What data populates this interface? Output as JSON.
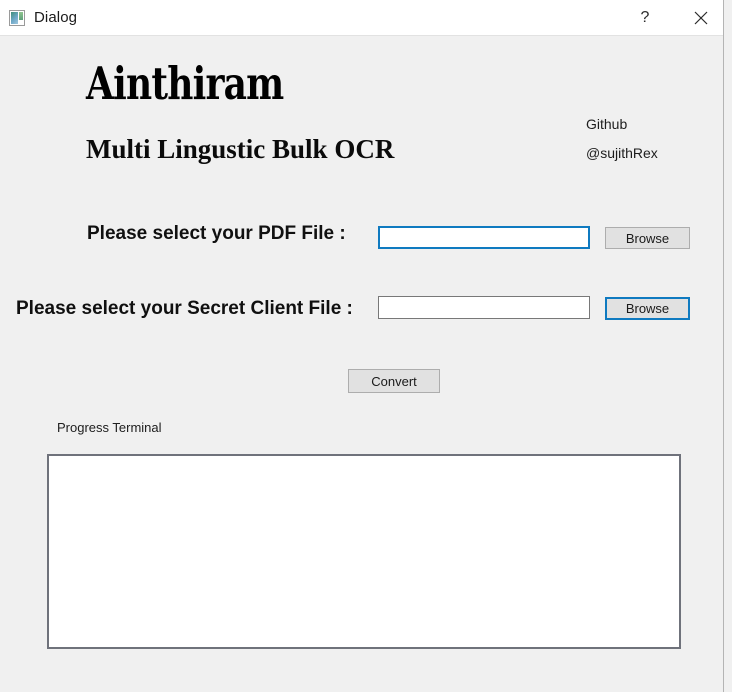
{
  "window": {
    "title": "Dialog",
    "icon": "app-picture-icon",
    "help_label": "?",
    "close_label": "×"
  },
  "header": {
    "brand": "Ainthiram",
    "subtitle": "Multi Lingustic Bulk OCR",
    "credit_service": "Github",
    "credit_handle": "@sujithRex"
  },
  "form": {
    "pdf_row": {
      "label": "Please select your PDF  File  :",
      "input_value": "",
      "input_placeholder": "",
      "browse_label": "Browse",
      "focused": true
    },
    "secret_row": {
      "label": "Please select your Secret Client  File  :",
      "input_value": "",
      "input_placeholder": "",
      "browse_label": "Browse",
      "focused": false
    },
    "convert_label": "Convert"
  },
  "terminal": {
    "label": "Progress Terminal",
    "content": ""
  },
  "colors": {
    "window_bg": "#f0f0f0",
    "titlebar_bg": "#ffffff",
    "accent_focus": "#0f7ac0",
    "button_bg": "#e1e1e1",
    "button_border": "#adadad",
    "terminal_border": "#6f727b",
    "input_border": "#787878"
  }
}
